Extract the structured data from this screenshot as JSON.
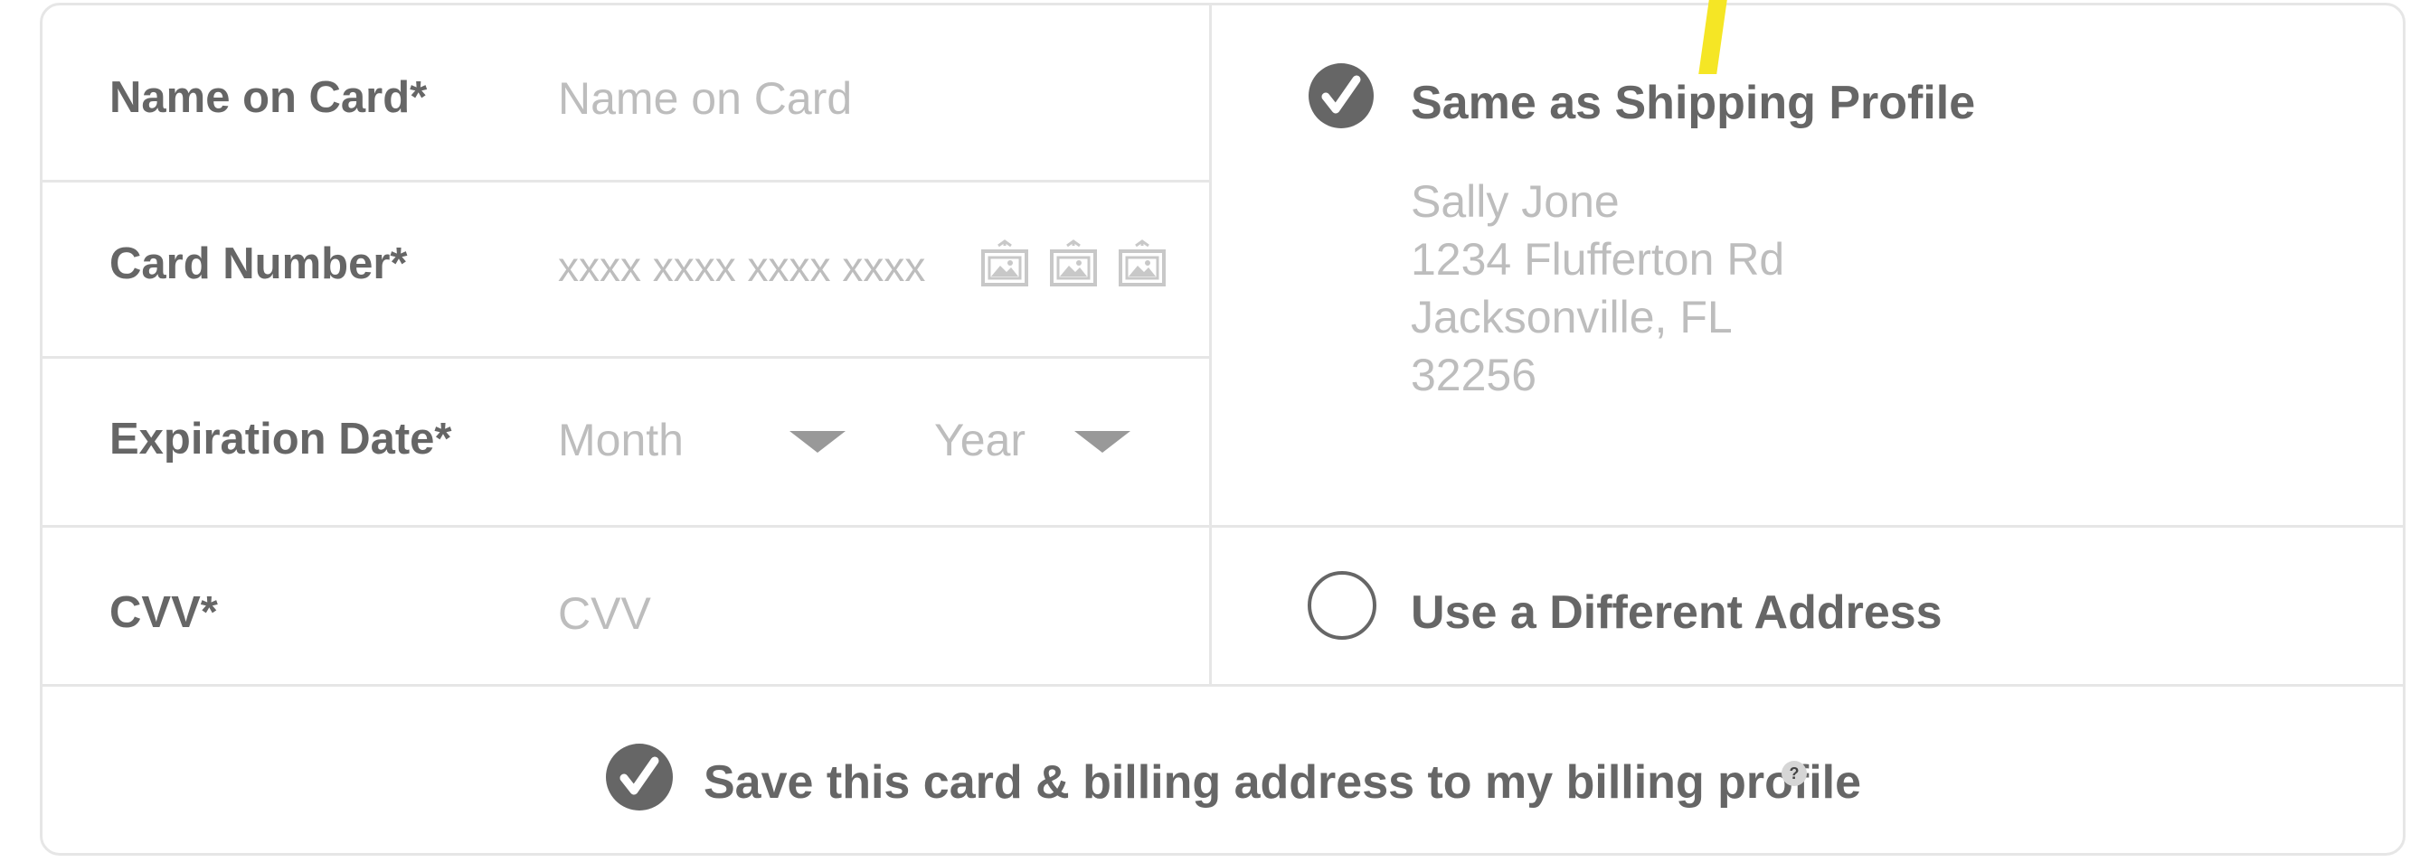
{
  "form": {
    "name_on_card": {
      "label": "Name on Card*",
      "placeholder": "Name on Card"
    },
    "card_number": {
      "label": "Card Number*",
      "placeholder": "xxxx xxxx xxxx xxxx",
      "card_icons": [
        "image-icon",
        "image-icon",
        "image-icon"
      ]
    },
    "expiration": {
      "label": "Expiration Date*",
      "month_placeholder": "Month",
      "year_placeholder": "Year"
    },
    "cvv": {
      "label": "CVV*",
      "placeholder": "CVV"
    }
  },
  "billing": {
    "same_as_shipping": {
      "label": "Same as Shipping Profile",
      "checked": true,
      "address_lines": [
        "Sally Jone",
        "1234 Flufferton Rd",
        "Jacksonville, FL",
        "32256"
      ]
    },
    "different_address": {
      "label": "Use a Different Address",
      "checked": false
    }
  },
  "save_card": {
    "label": "Save this card & billing address to my billing profile",
    "checked": true,
    "help_glyph": "?"
  },
  "colors": {
    "label": "#666666",
    "placeholder": "#bdbdbd",
    "border": "#e6e6e6",
    "check": "#666666",
    "stray_mark": "#f5e625"
  }
}
